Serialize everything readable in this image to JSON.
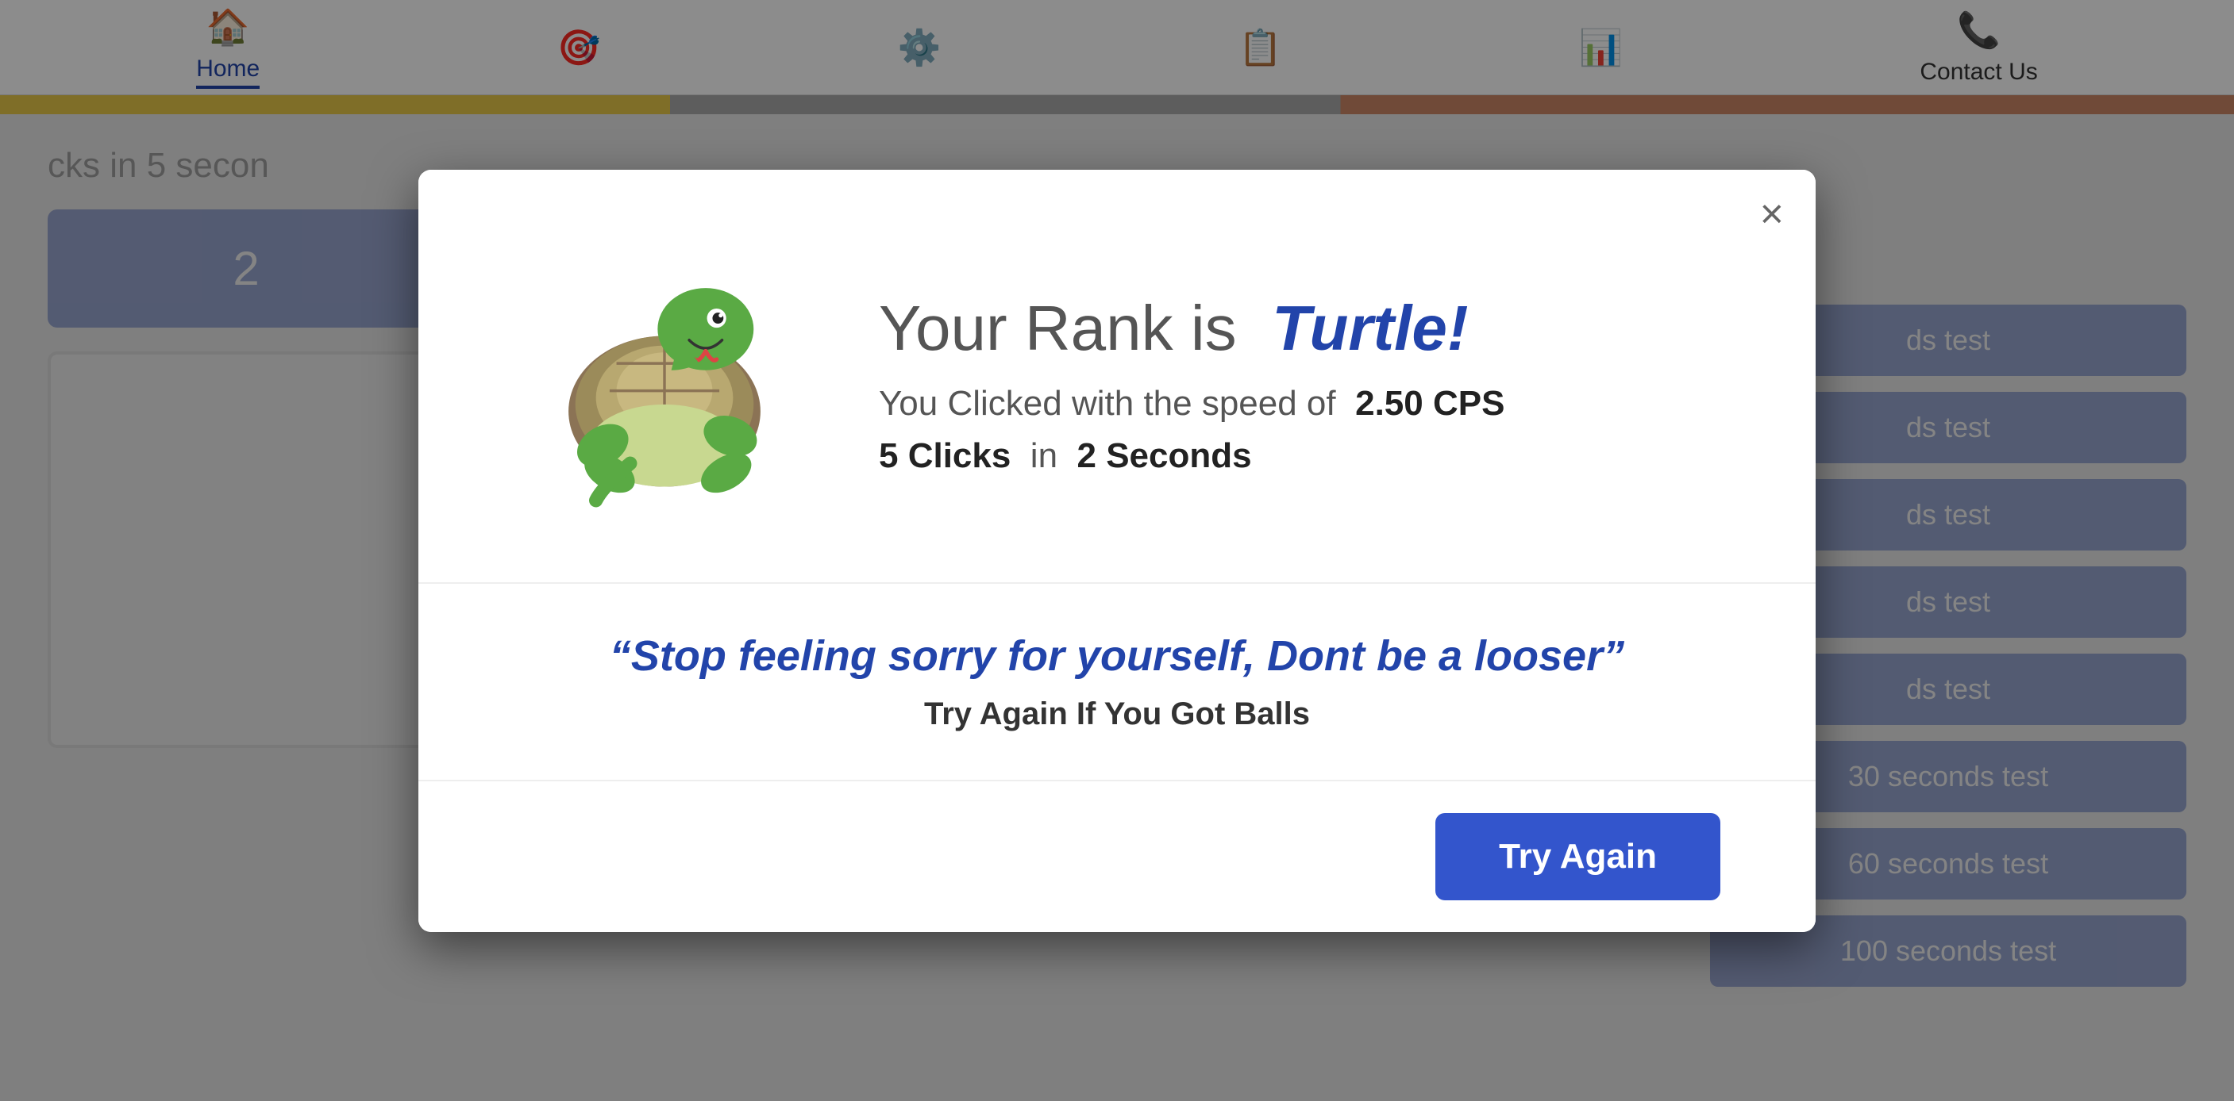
{
  "navbar": {
    "items": [
      {
        "id": "home",
        "label": "Home",
        "icon": "🏠",
        "active": true
      },
      {
        "id": "nav2",
        "label": "",
        "icon": "🎯",
        "active": false
      },
      {
        "id": "nav3",
        "label": "",
        "icon": "⚙️",
        "active": false
      },
      {
        "id": "nav4",
        "label": "",
        "icon": "📋",
        "active": false
      },
      {
        "id": "nav5",
        "label": "",
        "icon": "📊",
        "active": false
      },
      {
        "id": "contact",
        "label": "Contact Us",
        "icon": "📞",
        "active": false
      }
    ]
  },
  "background": {
    "title": "cks in 5 secon",
    "click_button_label": "2",
    "test_buttons": [
      "ds test",
      "ds test",
      "ds test",
      "ds test",
      "ds test",
      "30 seconds test",
      "60 seconds test",
      "100 seconds test"
    ]
  },
  "modal": {
    "close_label": "×",
    "rank_prefix": "Your Rank is",
    "rank_name": "Turtle!",
    "cps_prefix": "You Clicked with the speed of",
    "cps_value": "2.50 CPS",
    "clicks_count": "5 Clicks",
    "clicks_suffix": "in",
    "seconds_value": "2 Seconds",
    "quote": "“Stop feeling sorry for yourself, Dont be a looser”",
    "sub_text": "Try Again If You Got Balls",
    "try_again_label": "Try Again"
  }
}
